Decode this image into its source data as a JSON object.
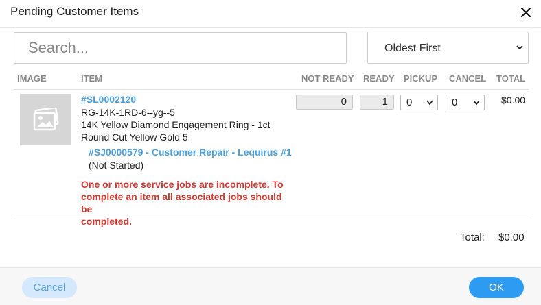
{
  "dialog": {
    "title": "Pending Customer Items"
  },
  "search": {
    "placeholder": "Search..."
  },
  "sort": {
    "selected": "Oldest First"
  },
  "columns": {
    "image": "IMAGE",
    "item": "ITEM",
    "not_ready": "NOT READY",
    "ready": "READY",
    "pickup": "PICKUP",
    "cancel": "CANCEL",
    "total": "TOTAL"
  },
  "items": [
    {
      "sku_link": "#SL0002120",
      "code": "RG-14K-1RD-6--yg--5",
      "description_line1": "14K Yellow Diamond Engagement Ring - 1ct",
      "description_line2": "Round Cut Yellow Gold 5",
      "job_link": "#SJ0000579 - Customer Repair - Lequirus #1",
      "job_status": "(Not Started)",
      "warning_line1": "One or more service jobs are incomplete. To",
      "warning_line2": "complete an item all associated jobs should be",
      "warning_line3": "completed.",
      "not_ready": "0",
      "ready": "1",
      "pickup": "0",
      "cancel": "0",
      "total": "$0.00"
    }
  ],
  "summary": {
    "total_label": "Total:",
    "total_value": "$0.00"
  },
  "footer": {
    "cancel_label": "Cancel",
    "ok_label": "OK"
  },
  "colors": {
    "link": "#4a9fdf",
    "warning": "#d0392f",
    "primary": "#2e9bf2",
    "secondary_bg": "#d4e9fb"
  }
}
